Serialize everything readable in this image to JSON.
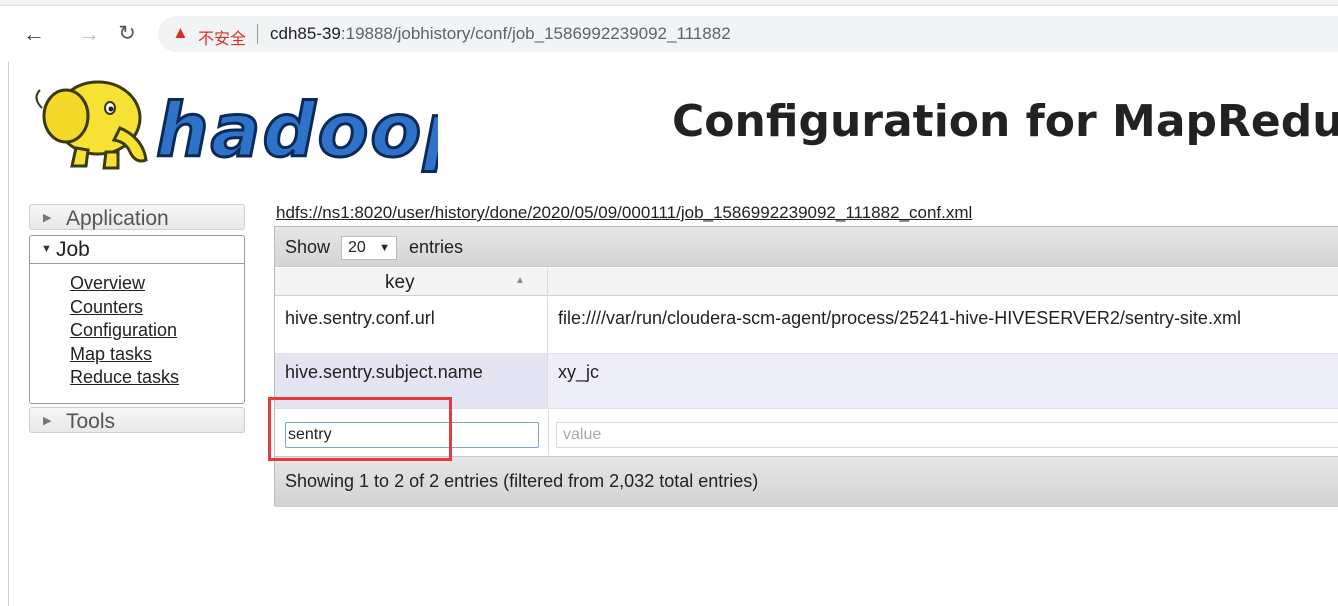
{
  "browser": {
    "insecure_label": "不安全",
    "url_host": "cdh85-39",
    "url_rest": ":19888/jobhistory/conf/job_1586992239092_111882"
  },
  "header": {
    "logo_text": "hadoop",
    "title": "Configuration for MapRedu"
  },
  "sidebar": {
    "application_label": "Application",
    "job_label": "Job",
    "job_links": [
      "Overview",
      "Counters",
      "Configuration",
      "Map tasks",
      "Reduce tasks"
    ],
    "tools_label": "Tools"
  },
  "main": {
    "conf_path": "hdfs://ns1:8020/user/history/done/2020/05/09/000111/job_1586992239092_111882_conf.xml",
    "length": {
      "show_label": "Show",
      "selected": "20",
      "entries_label": "entries"
    },
    "table": {
      "key_header": "key",
      "rows": [
        {
          "key": "hive.sentry.conf.url",
          "value": "file:////var/run/cloudera-scm-agent/process/25241-hive-HIVESERVER2/sentry-site.xml"
        },
        {
          "key": "hive.sentry.subject.name",
          "value": "xy_jc"
        }
      ],
      "filter_key_value": "sentry",
      "filter_value_placeholder": "value"
    },
    "info": "Showing 1 to 2 of 2 entries (filtered from 2,032 total entries)"
  },
  "colors": {
    "highlight": "#e23c3c",
    "insecure": "#d93025",
    "logo_blue": "#2f73c9",
    "logo_yellow": "#f7e233"
  }
}
